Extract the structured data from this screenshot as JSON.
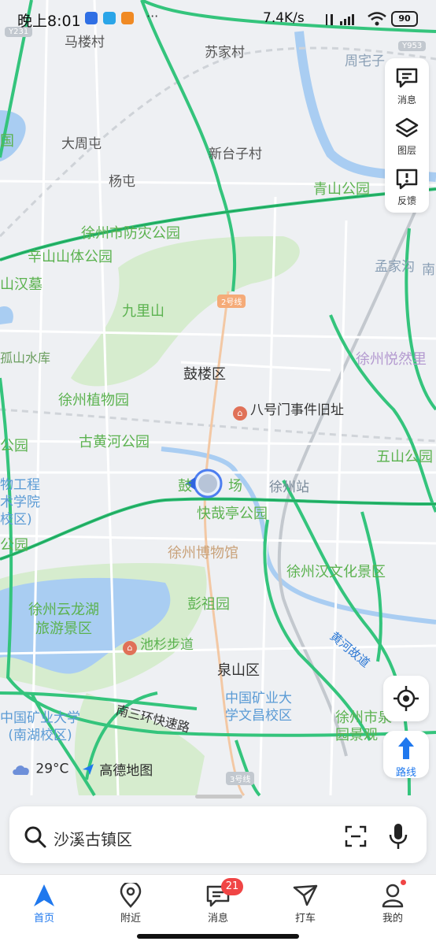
{
  "status_bar": {
    "time": "晚上8:01",
    "network_speed": "7.4K/s",
    "battery": "90"
  },
  "map": {
    "labels": {
      "malou": "马楼村",
      "sujia": "苏家村",
      "zhouzhai": "周宅子",
      "dazhoutun": "大周屯",
      "yangtun": "杨屯",
      "xintaizi": "新台子村",
      "qingshan": "青山公园",
      "fangzai": "徐州市防灾公园",
      "xinshan": "辛山山体公园",
      "shanhan": "山汉墓",
      "jiuli": "九里山",
      "mengjia": "孟家沟",
      "gulou": "鼓楼区",
      "guhushuiku": "孤山水库",
      "yueran": "徐州悦然里",
      "zhiwuyuan": "徐州植物园",
      "bahaomen": "八号门事件旧址",
      "guhuanghe": "古黄河公园",
      "wushan": "五山公园",
      "xuzhou_station": "徐州站",
      "kuaizai": "快哉亭公园",
      "gongcheng": "物工程\n术学院\n校区)",
      "bowuguan": "徐州博物馆",
      "hanwenhua": "徐州汉文化景区",
      "yunlonghu": "徐州云龙湖\n旅游景区",
      "pengzu": "彭祖园",
      "chishan": "池杉步道",
      "quanshan": "泉山区",
      "cumt_wenchang": "中国矿业大\n学文昌校区",
      "cumt_nanhu": "中国矿业大学\n(南湖校区)",
      "ring_road": "南三环快速路",
      "zhaoyuan": "徐州市泉\n园景观",
      "yellow_river": "黄河故道",
      "gongyuan_left": "公园",
      "gongyuan_left2": "公园",
      "shan_left": "山",
      "zhuangshi": "场",
      "guo_left": "国",
      "nan": "南",
      "gu": "鼓"
    },
    "shields": {
      "line2": "2号线",
      "line3": "3号线",
      "y231": "Y231",
      "y953": "Y953"
    }
  },
  "right_panel": {
    "messages": "消息",
    "layers": "图层",
    "feedback": "反馈"
  },
  "route_button": "路线",
  "weather": {
    "temperature": "29°C",
    "brand": "高德地图"
  },
  "search": {
    "query": "沙溪古镇区"
  },
  "tabbar": {
    "items": [
      {
        "label": "首页",
        "active": true
      },
      {
        "label": "附近"
      },
      {
        "label": "消息",
        "badge": "21"
      },
      {
        "label": "打车"
      },
      {
        "label": "我的"
      }
    ]
  },
  "colors": {
    "accent": "#1f78ee",
    "road_green": "#34c47c",
    "park": "#cde7c3",
    "water": "#a9cdf2",
    "badge": "#f04545"
  }
}
